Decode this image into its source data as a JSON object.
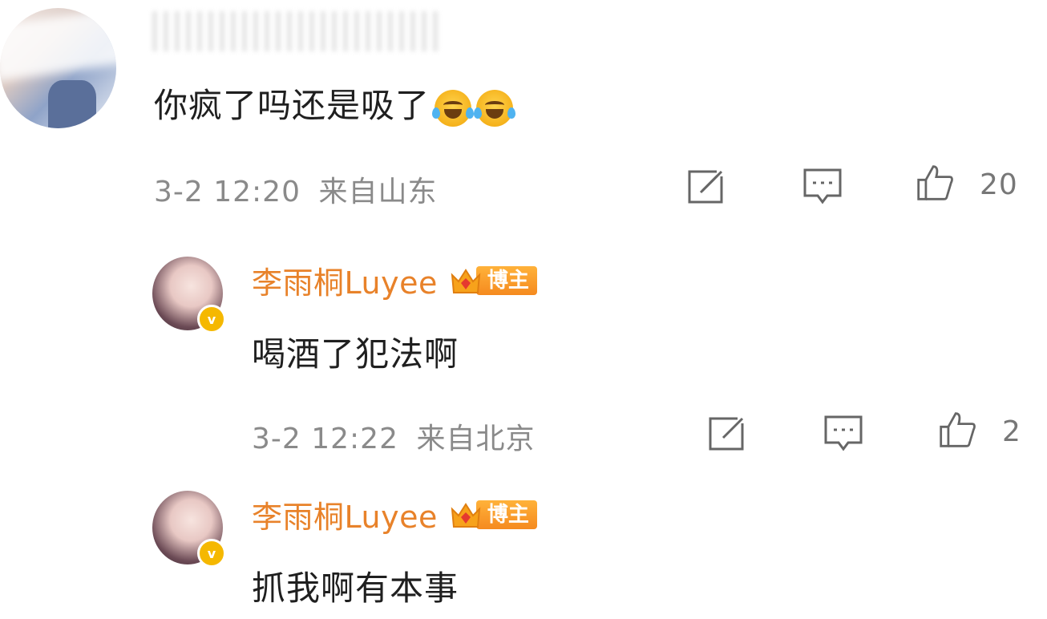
{
  "comment1": {
    "avatar_icon": "user-avatar",
    "text": "你疯了吗还是吸了",
    "emojis": [
      "laughing-crying-emoji",
      "laughing-crying-emoji"
    ],
    "timestamp": "3-2 12:20",
    "location": "来自山东",
    "like_count": "20"
  },
  "reply1": {
    "author": "李雨桐Luyee",
    "badge_label": "博主",
    "text": "喝酒了犯法啊",
    "timestamp": "3-2 12:22",
    "location": "来自北京",
    "like_count": "2"
  },
  "reply2": {
    "author": "李雨桐Luyee",
    "badge_label": "博主",
    "text": "抓我啊有本事"
  },
  "colors": {
    "author_name": "#e8822a",
    "meta_text": "#8a8a8a",
    "badge_orange": "#f58a1f",
    "verified_yellow": "#f5b800"
  }
}
